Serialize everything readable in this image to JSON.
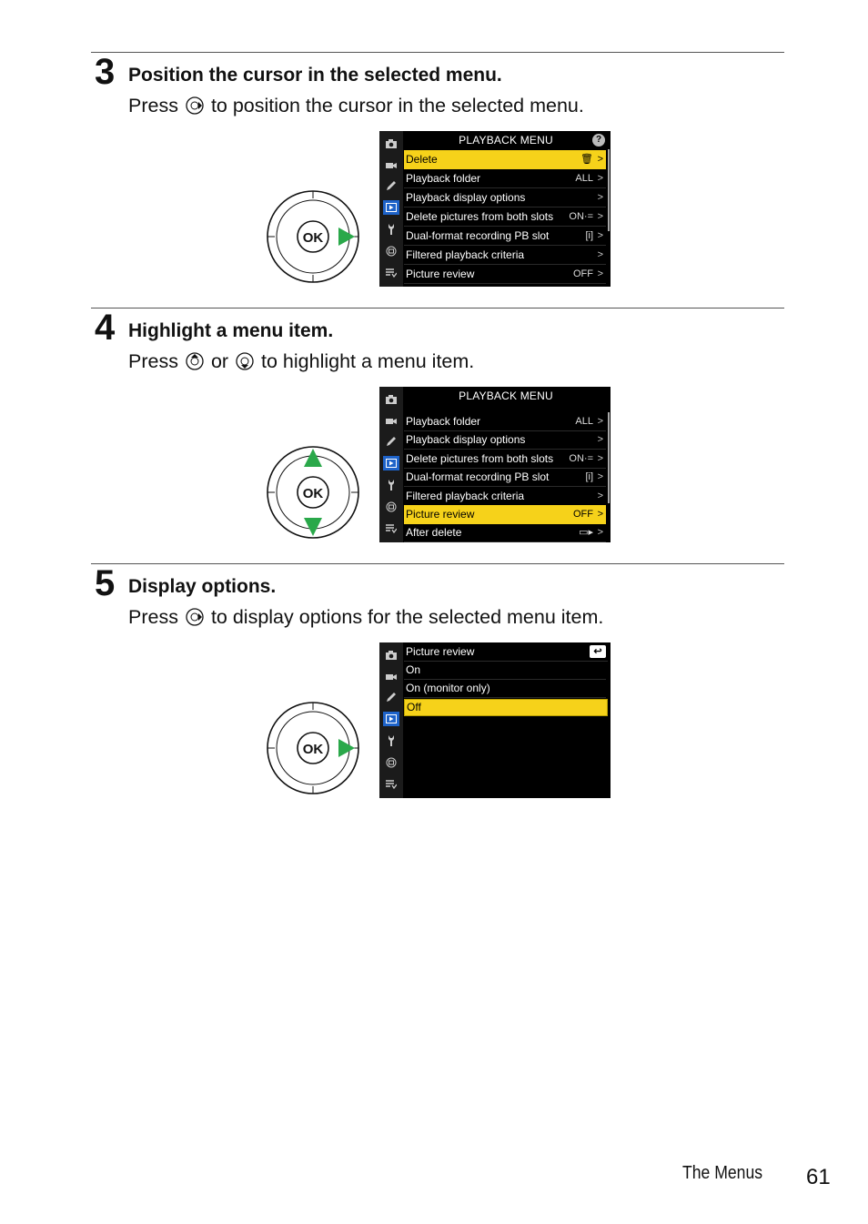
{
  "steps": [
    {
      "number": "3",
      "title": "Position the cursor in the selected menu.",
      "desc_before": "Press",
      "desc_after": "to position the cursor in the selected menu.",
      "button_icon": "multi-selector-right-icon"
    },
    {
      "number": "4",
      "title": "Highlight a menu item.",
      "desc_before": "Press",
      "desc_middle": "or",
      "desc_after": "to highlight a menu item.",
      "button_icon": "multi-selector-up-icon",
      "button_icon_2": "multi-selector-down-icon"
    },
    {
      "number": "5",
      "title": "Display options.",
      "desc_before": "Press",
      "desc_after": "to display options for the selected menu item.",
      "button_icon": "multi-selector-right-icon"
    }
  ],
  "dial": {
    "center_label": "OK",
    "arrow_color": "#2aa84a"
  },
  "screen1": {
    "title": "PLAYBACK MENU",
    "help": "?",
    "items": [
      {
        "label": "Delete",
        "value": "🗑",
        "arrow": ">"
      },
      {
        "label": "Playback folder",
        "value": "ALL",
        "arrow": ">"
      },
      {
        "label": "Playback display options",
        "value": "",
        "arrow": ">"
      },
      {
        "label": "Delete pictures from both slots",
        "value": "ON·=",
        "arrow": ">"
      },
      {
        "label": "Dual-format recording PB slot",
        "value": "[i]",
        "arrow": ">"
      },
      {
        "label": "Filtered playback criteria",
        "value": "",
        "arrow": ">"
      },
      {
        "label": "Picture review",
        "value": "OFF",
        "arrow": ">"
      }
    ]
  },
  "screen2": {
    "title": "PLAYBACK MENU",
    "items": [
      {
        "label": "Playback folder",
        "value": "ALL",
        "arrow": ">"
      },
      {
        "label": "Playback display options",
        "value": "",
        "arrow": ">"
      },
      {
        "label": "Delete pictures from both slots",
        "value": "ON·=",
        "arrow": ">"
      },
      {
        "label": "Dual-format recording PB slot",
        "value": "[i]",
        "arrow": ">"
      },
      {
        "label": "Filtered playback criteria",
        "value": "",
        "arrow": ">"
      },
      {
        "label": "Picture review",
        "value": "OFF",
        "arrow": ">"
      },
      {
        "label": "After delete",
        "value": "▭▸",
        "arrow": ">"
      }
    ]
  },
  "screen3": {
    "title": "Picture review",
    "back": "↩",
    "options": [
      "On",
      "On (monitor only)",
      "Off"
    ]
  },
  "sidebar_icons": [
    "camera-icon",
    "movie-icon",
    "pencil-icon",
    "playback-icon",
    "wrench-icon",
    "retouch-icon",
    "my-menu-icon"
  ],
  "colors": {
    "highlight": "#f6d21a",
    "active_tab": "#1e63c9"
  },
  "footer": {
    "section": "The Menus",
    "page": "61"
  }
}
